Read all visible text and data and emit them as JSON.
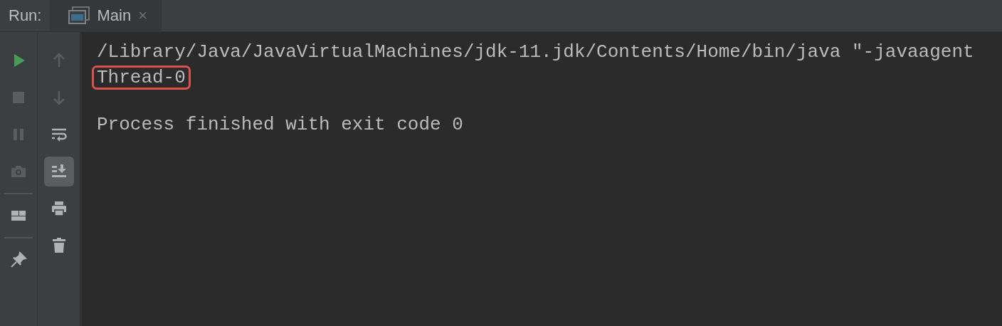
{
  "panel": {
    "title": "Run:"
  },
  "tabs": [
    {
      "label": "Main",
      "selected": true,
      "close": "×"
    }
  ],
  "toolbar_left": [
    {
      "kind": "run",
      "disabled": false,
      "selected": false
    },
    {
      "kind": "stop",
      "disabled": true,
      "selected": false
    },
    {
      "kind": "pause",
      "disabled": true,
      "selected": false
    },
    {
      "kind": "camera",
      "disabled": true,
      "selected": false
    },
    {
      "kind": "separator"
    },
    {
      "kind": "layout",
      "disabled": false,
      "selected": false
    },
    {
      "kind": "separator"
    },
    {
      "kind": "pin",
      "disabled": false,
      "selected": false
    }
  ],
  "toolbar_right": [
    {
      "kind": "up",
      "disabled": true,
      "selected": false
    },
    {
      "kind": "down",
      "disabled": true,
      "selected": false
    },
    {
      "kind": "wrap",
      "disabled": false,
      "selected": false
    },
    {
      "kind": "scroll-end",
      "disabled": false,
      "selected": true
    },
    {
      "kind": "print",
      "disabled": false,
      "selected": false
    },
    {
      "kind": "trash",
      "disabled": false,
      "selected": false
    }
  ],
  "console": {
    "lines": [
      {
        "kind": "command",
        "text": "/Library/Java/JavaVirtualMachines/jdk-11.jdk/Contents/Home/bin/java \"-javaagent",
        "highlighted": false
      },
      {
        "kind": "output",
        "text": "Thread-0",
        "highlighted": true
      },
      {
        "kind": "exit",
        "text": "Process finished with exit code 0",
        "highlighted": false
      }
    ]
  }
}
